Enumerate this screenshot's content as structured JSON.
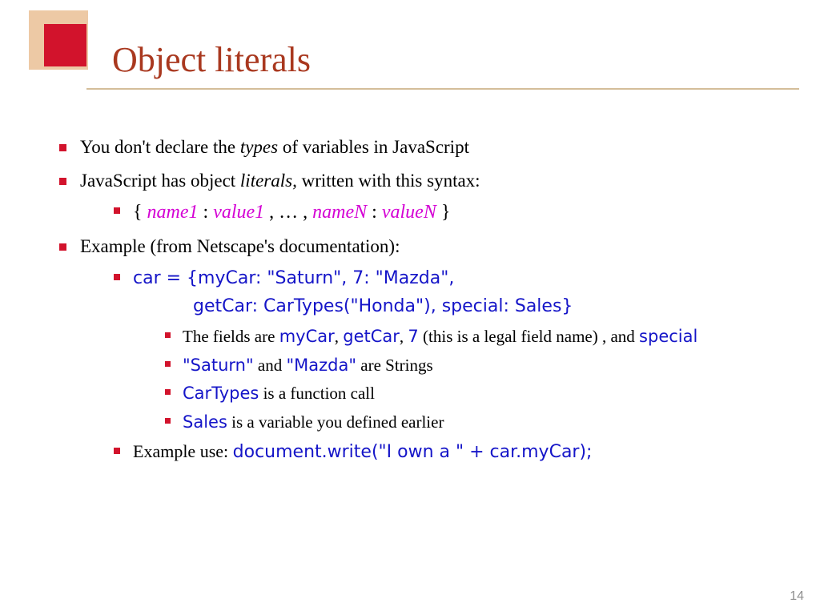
{
  "title": "Object literals",
  "bullets": {
    "b1_pre": "You don't declare the ",
    "b1_em": "types",
    "b1_post": " of variables in JavaScript",
    "b2_pre": "JavaScript has object ",
    "b2_em": "literals,",
    "b2_post": " written with this syntax:",
    "syntax_open": "{ ",
    "syntax_n1": "name1",
    "syntax_colon1": " : ",
    "syntax_v1": "value1",
    "syntax_mid": " , … , ",
    "syntax_nN": "nameN",
    "syntax_colon2": " : ",
    "syntax_vN": "valueN",
    "syntax_close": " }",
    "b3": "Example (from Netscape's documentation):",
    "code_line1": "car = {myCar: \"Saturn\",  7: \"Mazda\",",
    "code_line2": "getCar: CarTypes(\"Honda\"), special: Sales}",
    "fields_pre": "The fields are ",
    "fields_myCar": "myCar",
    "fields_c1": ", ",
    "fields_getCar": "getCar",
    "fields_c2": ", ",
    "fields_7": "7",
    "fields_legal": " (this is a legal field name) , and ",
    "fields_special": "special",
    "strings_s1": "\"Saturn\"",
    "strings_and": " and ",
    "strings_s2": "\"Mazda\"",
    "strings_post": " are Strings",
    "cartypes_code": "CarTypes",
    "cartypes_post": " is a function call",
    "sales_code": "Sales",
    "sales_post": " is a variable you defined earlier",
    "exuse_pre": "Example use: ",
    "exuse_code": "document.write(\"I own a \" + car.myCar);"
  },
  "page_number": "14"
}
